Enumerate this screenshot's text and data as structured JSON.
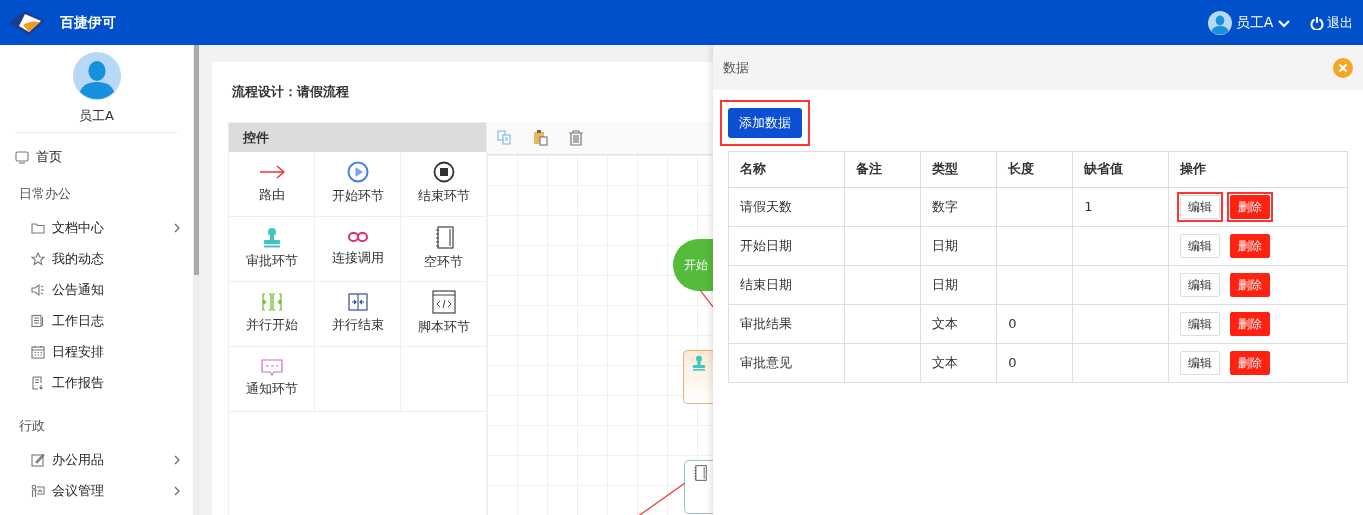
{
  "app": {
    "title": "百捷伊可"
  },
  "user_menu": {
    "name": "员工A",
    "logout": "退出"
  },
  "sidebar": {
    "user": "员工A",
    "items": [
      {
        "kind": "link",
        "label": "首页"
      },
      {
        "kind": "group",
        "label": "日常办公",
        "children": [
          {
            "label": "文档中心",
            "expandable": true
          },
          {
            "label": "我的动态",
            "expandable": false
          },
          {
            "label": "公告通知",
            "expandable": false
          },
          {
            "label": "工作日志",
            "expandable": false
          },
          {
            "label": "日程安排",
            "expandable": false
          },
          {
            "label": "工作报告",
            "expandable": false
          }
        ]
      },
      {
        "kind": "group",
        "label": "行政",
        "children": [
          {
            "label": "办公用品",
            "expandable": true
          },
          {
            "label": "会议管理",
            "expandable": true
          }
        ]
      }
    ]
  },
  "designer": {
    "title": "流程设计：请假流程",
    "palette": {
      "title": "控件",
      "items": [
        {
          "kind": "route",
          "label": "路由"
        },
        {
          "kind": "start",
          "label": "开始环节"
        },
        {
          "kind": "end",
          "label": "结束环节"
        },
        {
          "kind": "approval",
          "label": "审批环节"
        },
        {
          "kind": "link",
          "label": "连接调用"
        },
        {
          "kind": "empty",
          "label": "空环节"
        },
        {
          "kind": "parallel_start",
          "label": "并行开始"
        },
        {
          "kind": "parallel_end",
          "label": "并行结束"
        },
        {
          "kind": "script",
          "label": "脚本环节"
        },
        {
          "kind": "notify",
          "label": "通知环节"
        }
      ]
    },
    "nodes": [
      {
        "kind": "start",
        "label": "开始"
      },
      {
        "kind": "approval"
      },
      {
        "kind": "empty"
      }
    ]
  },
  "panel": {
    "title": "数据",
    "add_button": {
      "label": "添加数据",
      "highlighted": true
    },
    "table": {
      "columns": [
        "名称",
        "备注",
        "类型",
        "长度",
        "缺省值",
        "操作"
      ],
      "rows": [
        {
          "cells": [
            "请假天数",
            "",
            "数字",
            "",
            "1"
          ],
          "actions": [
            {
              "kind": "edit",
              "label": "编辑",
              "highlighted": true
            },
            {
              "kind": "delete",
              "label": "删除",
              "highlighted": true
            }
          ]
        },
        {
          "cells": [
            "开始日期",
            "",
            "日期",
            "",
            ""
          ],
          "actions": [
            {
              "kind": "edit",
              "label": "编辑",
              "highlighted": false
            },
            {
              "kind": "delete",
              "label": "删除",
              "highlighted": false
            }
          ]
        },
        {
          "cells": [
            "结束日期",
            "",
            "日期",
            "",
            ""
          ],
          "actions": [
            {
              "kind": "edit",
              "label": "编辑",
              "highlighted": false
            },
            {
              "kind": "delete",
              "label": "删除",
              "highlighted": false
            }
          ]
        },
        {
          "cells": [
            "审批结果",
            "",
            "文本",
            "0",
            ""
          ],
          "actions": [
            {
              "kind": "edit",
              "label": "编辑",
              "highlighted": false
            },
            {
              "kind": "delete",
              "label": "删除",
              "highlighted": false
            }
          ]
        },
        {
          "cells": [
            "审批意见",
            "",
            "文本",
            "0",
            ""
          ],
          "actions": [
            {
              "kind": "edit",
              "label": "编辑",
              "highlighted": false
            },
            {
              "kind": "delete",
              "label": "删除",
              "highlighted": false
            }
          ]
        }
      ]
    }
  }
}
